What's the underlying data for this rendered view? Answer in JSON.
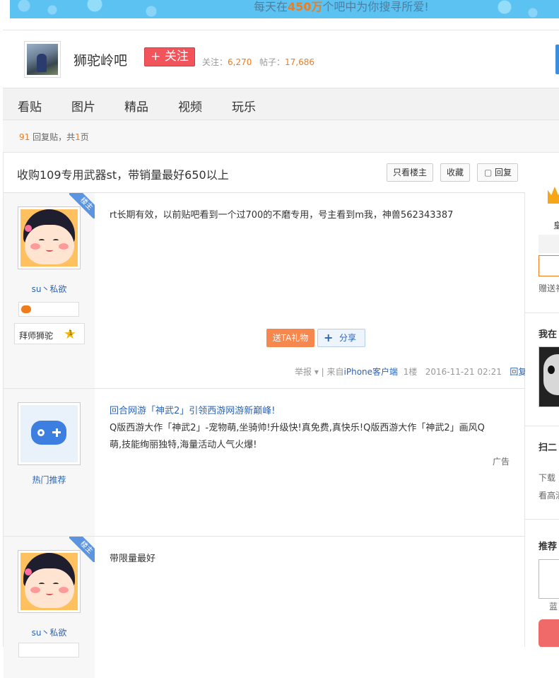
{
  "banner": {
    "pre": "每天在",
    "highlight": "450万",
    "post": "个吧中为你搜寻所爱!"
  },
  "forum": {
    "name": "狮驼岭吧",
    "follow_label": "+ 关注",
    "followers_label": "关注：",
    "followers": "6,270",
    "posts_label": "帖子：",
    "posts": "17,686"
  },
  "nav": [
    "看贴",
    "图片",
    "精品",
    "视频",
    "玩乐"
  ],
  "thread_info": {
    "replies": "91",
    "replies_suffix": " 回复贴，共",
    "pages": "1",
    "pages_suffix": "页"
  },
  "thread": {
    "title": "收购109专用武器st，带销量最好650以上",
    "buttons": [
      "只看楼主",
      "收藏",
      "回复"
    ]
  },
  "posts": [
    {
      "badge": "楼主",
      "username": "su丶私欲",
      "mentor": "拜师狮驼",
      "star_level": "1",
      "content": "rt长期有效，以前贴吧看到一个过700的不磨专用，号主看到m我，神兽562343387",
      "gift": "送TA礼物",
      "share": "分享",
      "report": "举报",
      "from_prefix": "| 来自",
      "client": "iPhone客户端",
      "floor": "1楼",
      "time": "2016-11-21 02:21",
      "reply": "回复"
    },
    {
      "ad_name": "热门推荐",
      "ad_title": "回合网游「神武2」引领西游网游新巅峰!",
      "ad_line1": "Q版西游大作「神武2」-宠物萌,坐骑帅!升级快!真免费,真快乐!Q版西游大作「神武2」画风Q",
      "ad_line2": "萌,技能绚丽独特,海量活动人气火爆!",
      "ad_tag": "广告"
    },
    {
      "badge": "楼主",
      "username": "su丶私欲",
      "content": "带限量最好"
    }
  ],
  "aside": {
    "crown_caption": "皇",
    "gift_note": "赠送礼",
    "section1": "我在",
    "section2": "扫二",
    "download": "下载",
    "watch": "看高清",
    "recommend": "推荐",
    "item_caption": "蓝"
  },
  "colors": {
    "accent_blue": "#2d64b3",
    "orange": "#f07c1c",
    "follow_red": "#f2545b",
    "banner_blue": "#5cc2f2"
  }
}
